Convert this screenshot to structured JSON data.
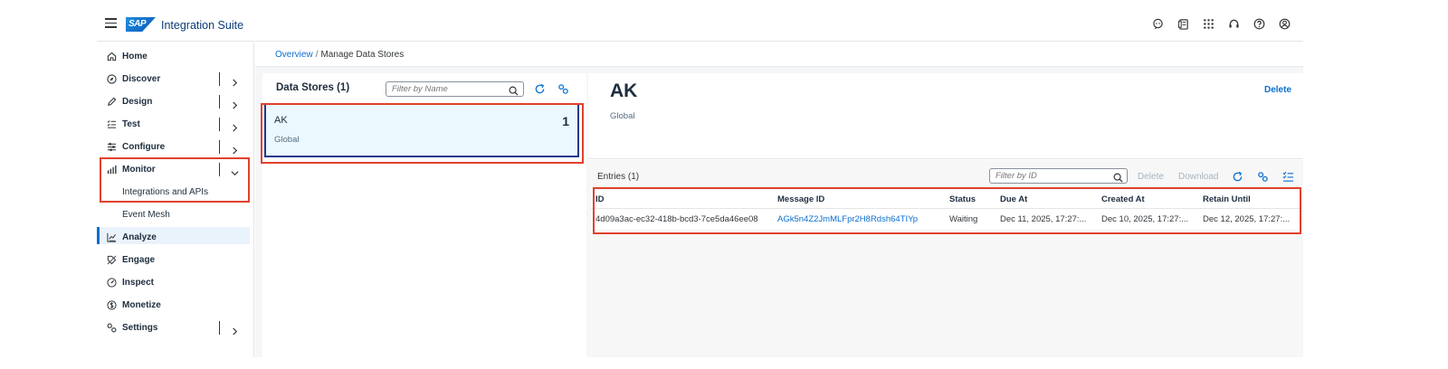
{
  "shell": {
    "logo_text": "SAP",
    "product": "Integration Suite",
    "icons": [
      "joule-icon",
      "notes-icon",
      "product-switch-icon",
      "support-icon",
      "help-icon",
      "user-icon"
    ]
  },
  "sidebar": {
    "items": [
      {
        "label": "Home",
        "icon": "home-icon"
      },
      {
        "label": "Discover",
        "icon": "compass-icon"
      },
      {
        "label": "Design",
        "icon": "pencil-icon"
      },
      {
        "label": "Test",
        "icon": "checklist-icon"
      },
      {
        "label": "Configure",
        "icon": "sliders-icon"
      },
      {
        "label": "Monitor",
        "icon": "bar-chart-icon"
      },
      {
        "label": "Integrations and APIs"
      },
      {
        "label": "Event Mesh"
      },
      {
        "label": "Analyze",
        "icon": "line-chart-icon"
      },
      {
        "label": "Engage",
        "icon": "tag-icon"
      },
      {
        "label": "Inspect",
        "icon": "gauge-icon"
      },
      {
        "label": "Monetize",
        "icon": "dollar-icon"
      },
      {
        "label": "Settings",
        "icon": "gears-icon"
      }
    ]
  },
  "breadcrumb": {
    "link": "Overview",
    "separator": "/",
    "current": "Manage Data Stores"
  },
  "data_stores": {
    "title": "Data Stores (1)",
    "filter_placeholder": "Filter by Name",
    "items": [
      {
        "name": "AK",
        "count": "1",
        "scope": "Global"
      }
    ]
  },
  "detail": {
    "title": "AK",
    "subtitle": "Global",
    "delete_label": "Delete"
  },
  "entries": {
    "title": "Entries (1)",
    "filter_placeholder": "Filter by ID",
    "delete_label": "Delete",
    "download_label": "Download",
    "columns": [
      "ID",
      "Message ID",
      "Status",
      "Due At",
      "Created At",
      "Retain Until"
    ],
    "rows": [
      {
        "id": "4d09a3ac-ec32-418b-bcd3-7ce5da46ee08",
        "message_id": "AGk5n4Z2JmMLFpr2H8Rdsh64TIYp",
        "status": "Waiting",
        "due_at": "Dec 11, 2025, 17:27:...",
        "created_at": "Dec 10, 2025, 17:27:...",
        "retain_until": "Dec 12, 2025, 17:27:..."
      }
    ]
  },
  "colors": {
    "accent": "#0a6ed1",
    "highlight_box": "#e1412c",
    "selected_card_bg": "#ebf8ff",
    "selected_card_border": "#1e3a8a"
  }
}
